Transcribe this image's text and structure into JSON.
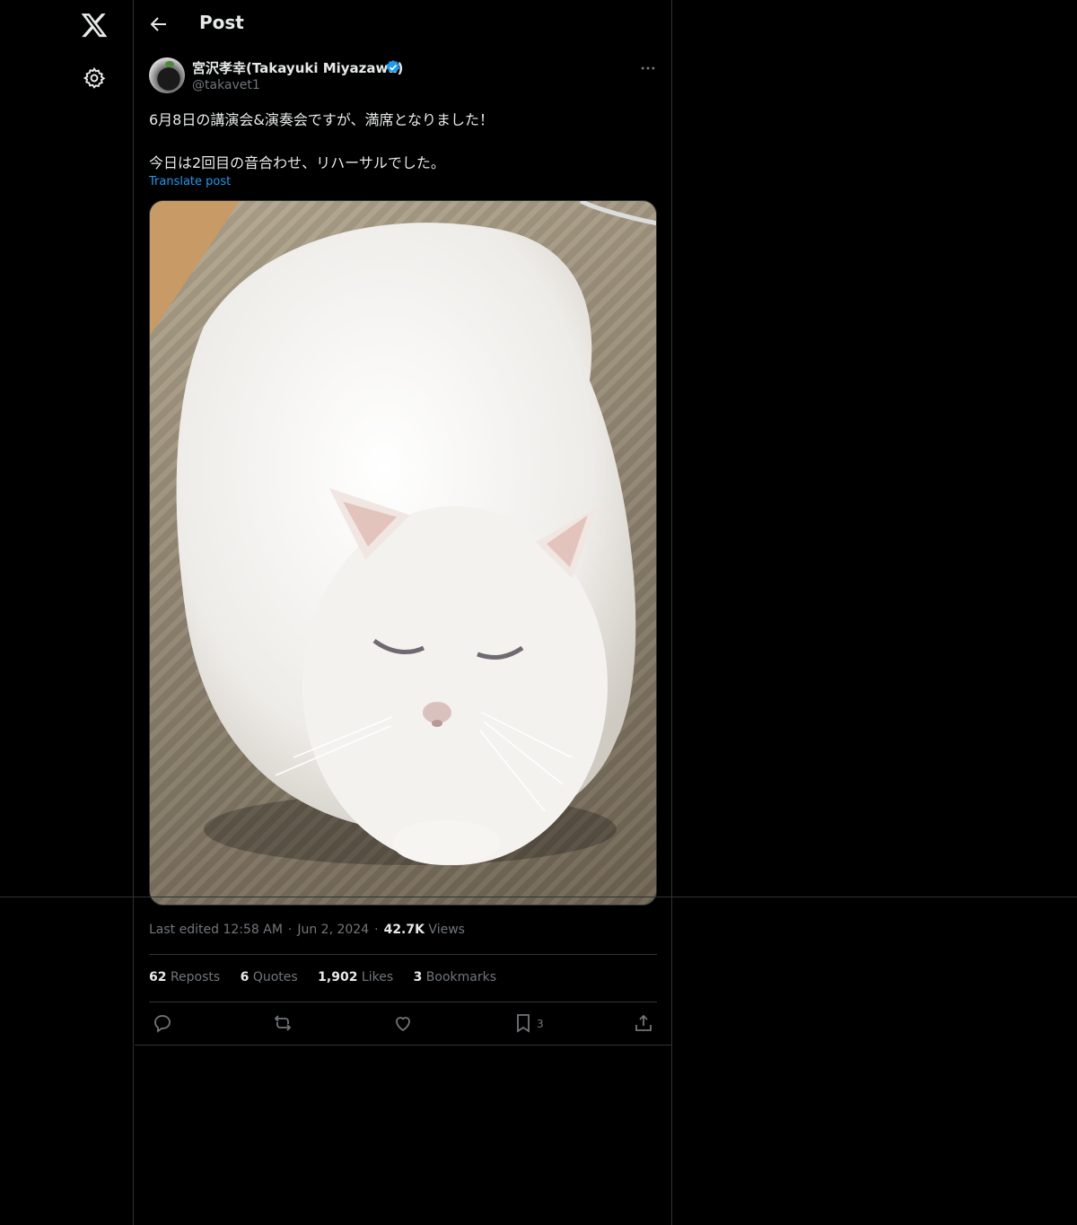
{
  "header": {
    "title": "Post"
  },
  "post": {
    "author_name": "宮沢孝幸(Takayuki Miyazawa)",
    "handle": "@takavet1",
    "text_lines": [
      "6月8日の講演会&演奏会ですが、満席となりました！",
      "今日は2回目の音合わせ、リハーサルでした。"
    ],
    "translate_label": "Translate post",
    "meta": {
      "edited_label": "Last edited 12:58 AM",
      "date": "Jun 2, 2024",
      "views_count": "42.7K",
      "views_label": "Views"
    },
    "stats": {
      "reposts_count": "62",
      "reposts_label": "Reposts",
      "quotes_count": "6",
      "quotes_label": "Quotes",
      "likes_count": "1,902",
      "likes_label": "Likes",
      "bookmarks_count": "3",
      "bookmarks_label": "Bookmarks"
    },
    "actions": {
      "bookmark_count": "3"
    }
  },
  "colors": {
    "accent": "#1d9bf0",
    "text": "#e7e9ea",
    "muted": "#71767b",
    "border": "#2f3336"
  },
  "icons": [
    "x-logo-icon",
    "gear-icon",
    "back-arrow-icon",
    "verified-badge-icon",
    "more-icon",
    "reply-icon",
    "repost-icon",
    "like-icon",
    "bookmark-icon",
    "share-icon"
  ]
}
